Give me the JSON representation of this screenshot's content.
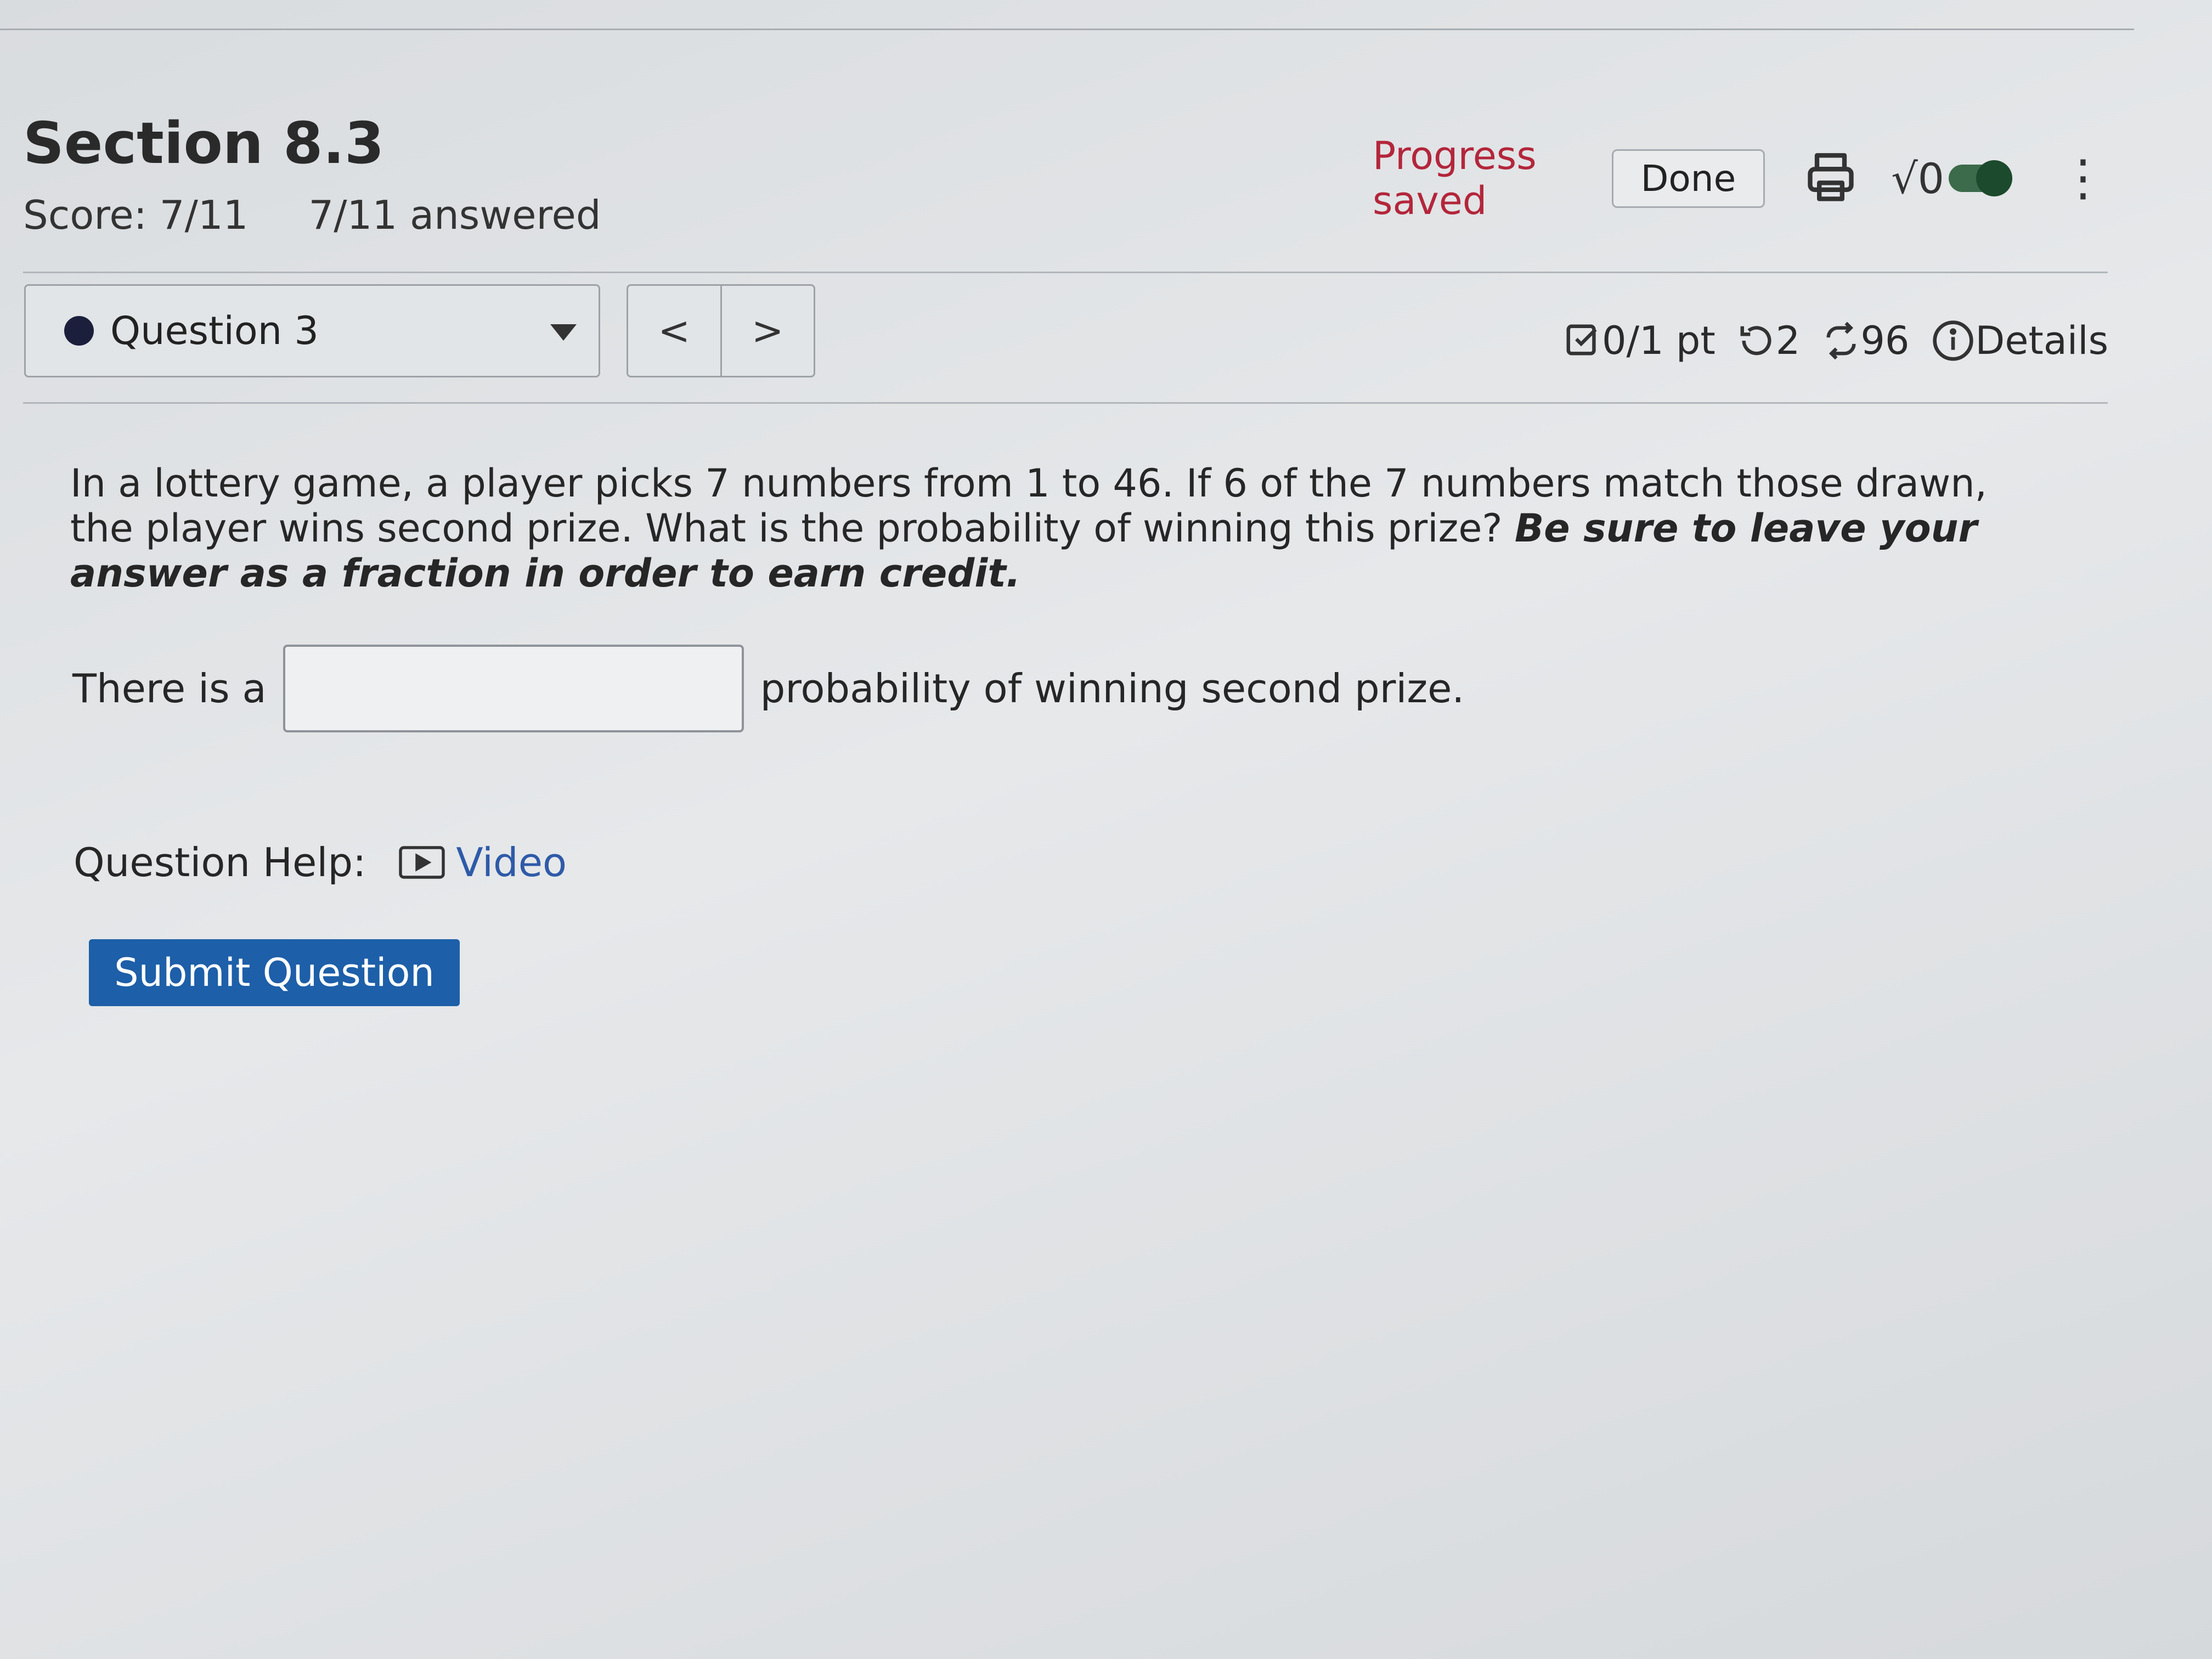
{
  "header": {
    "title": "Section 8.3",
    "score": "Score: 7/11",
    "answered": "7/11 answered",
    "progress_status": "Progress saved",
    "done_label": "Done",
    "math_label": "√0"
  },
  "question_nav": {
    "selected": "Question 3",
    "prev_label": "<",
    "next_label": ">"
  },
  "meta": {
    "points": "0/1 pt",
    "retries": "2",
    "attempts": "96",
    "details_label": "Details"
  },
  "question": {
    "text": "In a lottery game, a player picks 7 numbers from 1 to 46. If 6 of the 7 numbers match those drawn, the player wins second prize. What is the probability of winning this prize?",
    "emphasis": "Be sure to leave your answer as a fraction in order to earn credit.",
    "answer_prefix": "There is a",
    "answer_suffix": "probability of winning second prize.",
    "answer_value": ""
  },
  "help": {
    "label": "Question Help:",
    "video_label": "Video"
  },
  "submit_label": "Submit Question",
  "colors": {
    "accent": "#1d5fa8",
    "progress": "#b3263b",
    "toggle": "#1c4a2c"
  }
}
